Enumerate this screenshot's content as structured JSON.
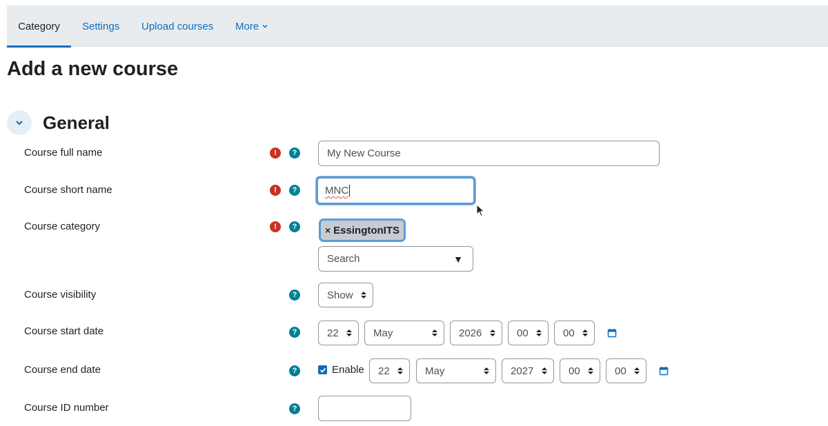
{
  "nav": {
    "tabs": [
      {
        "label": "Category",
        "active": true
      },
      {
        "label": "Settings"
      },
      {
        "label": "Upload courses"
      },
      {
        "label": "More"
      }
    ]
  },
  "page": {
    "title": "Add a new course"
  },
  "section": {
    "title": "General"
  },
  "colors": {
    "accent": "#0f6cbf",
    "required": "#ca3120",
    "help": "#008196",
    "focus": "#5b9bd5"
  },
  "form": {
    "fullname": {
      "label": "Course full name",
      "value": "My New Course"
    },
    "shortname": {
      "label": "Course short name",
      "value": "MNC"
    },
    "category": {
      "label": "Course category",
      "selected": "EssingtonITS",
      "remove_symbol": "×",
      "search_placeholder": "Search"
    },
    "visibility": {
      "label": "Course visibility",
      "value": "Show"
    },
    "startdate": {
      "label": "Course start date",
      "day": "22",
      "month": "May",
      "year": "2026",
      "hour": "00",
      "minute": "00"
    },
    "enddate": {
      "label": "Course end date",
      "enable_label": "Enable",
      "enabled": true,
      "day": "22",
      "month": "May",
      "year": "2027",
      "hour": "00",
      "minute": "00"
    },
    "idnumber": {
      "label": "Course ID number",
      "value": ""
    }
  },
  "icons": {
    "required": "exclamation-circle-icon",
    "help": "question-circle-icon",
    "calendar": "calendar-icon",
    "collapse": "chevron-down-icon"
  }
}
